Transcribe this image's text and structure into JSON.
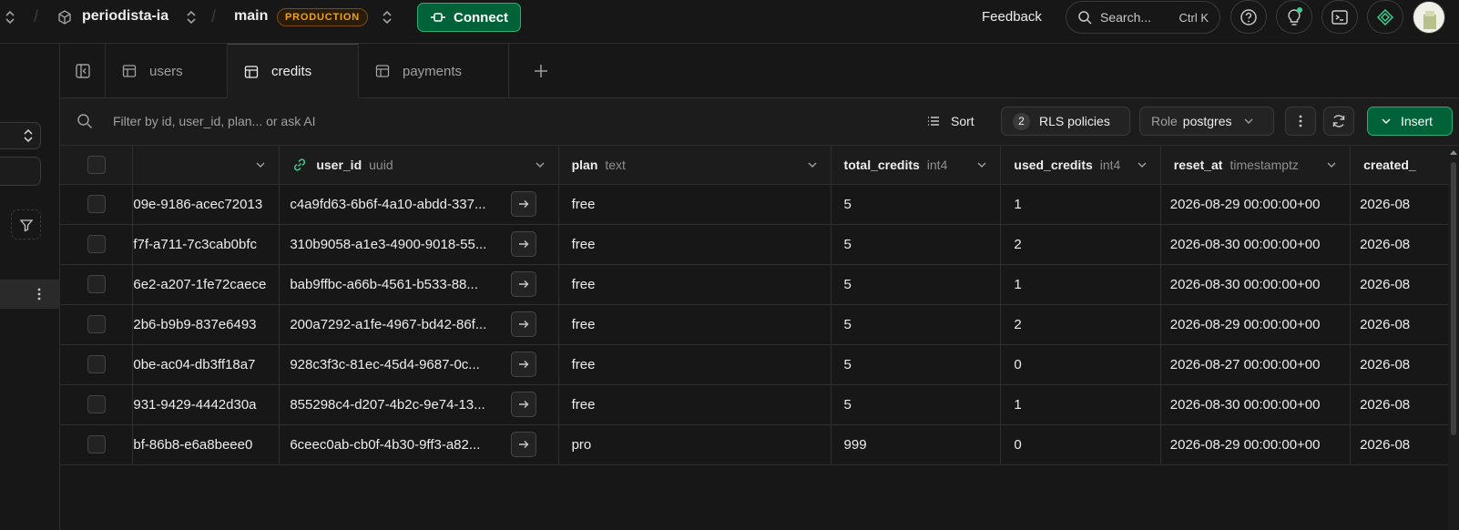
{
  "topbar": {
    "project": "periodista-ia",
    "branch": "main",
    "env_badge": "PRODUCTION",
    "connect_label": "Connect",
    "feedback_label": "Feedback",
    "search_label": "Search...",
    "search_shortcut": "Ctrl K"
  },
  "tabs": [
    {
      "label": "users"
    },
    {
      "label": "credits"
    },
    {
      "label": "payments"
    }
  ],
  "toolbar": {
    "filter_placeholder": "Filter by id, user_id, plan... or ask AI",
    "sort_label": "Sort",
    "rls_count": "2",
    "rls_label": "RLS policies",
    "role_label": "Role",
    "role_value": "postgres",
    "insert_label": "Insert"
  },
  "columns": [
    {
      "name": "",
      "type": ""
    },
    {
      "name": "user_id",
      "type": "uuid"
    },
    {
      "name": "plan",
      "type": "text"
    },
    {
      "name": "total_credits",
      "type": "int4"
    },
    {
      "name": "used_credits",
      "type": "int4"
    },
    {
      "name": "reset_at",
      "type": "timestamptz"
    },
    {
      "name": "created_",
      "type": ""
    }
  ],
  "rows": [
    {
      "id": "09e-9186-acec72013",
      "user_id": "c4a9fd63-6b6f-4a10-abdd-337...",
      "plan": "free",
      "total": "5",
      "used": "1",
      "reset": "2026-08-29 00:00:00+00",
      "created": "2026-08"
    },
    {
      "id": "f7f-a711-7c3cab0bfc",
      "user_id": "310b9058-a1e3-4900-9018-55...",
      "plan": "free",
      "total": "5",
      "used": "2",
      "reset": "2026-08-30 00:00:00+00",
      "created": "2026-08"
    },
    {
      "id": "6e2-a207-1fe72caece",
      "user_id": "bab9ffbc-a66b-4561-b533-88...",
      "plan": "free",
      "total": "5",
      "used": "1",
      "reset": "2026-08-30 00:00:00+00",
      "created": "2026-08"
    },
    {
      "id": "2b6-b9b9-837e6493",
      "user_id": "200a7292-a1fe-4967-bd42-86f...",
      "plan": "free",
      "total": "5",
      "used": "2",
      "reset": "2026-08-29 00:00:00+00",
      "created": "2026-08"
    },
    {
      "id": "0be-ac04-db3ff18a7",
      "user_id": "928c3f3c-81ec-45d4-9687-0c...",
      "plan": "free",
      "total": "5",
      "used": "0",
      "reset": "2026-08-27 00:00:00+00",
      "created": "2026-08"
    },
    {
      "id": "931-9429-4442d30a",
      "user_id": "855298c4-d207-4b2c-9e74-13...",
      "plan": "free",
      "total": "5",
      "used": "1",
      "reset": "2026-08-30 00:00:00+00",
      "created": "2026-08"
    },
    {
      "id": "bf-86b8-e6a8beee0",
      "user_id": "6ceec0ab-cb0f-4b30-9ff3-a82...",
      "plan": "pro",
      "total": "999",
      "used": "0",
      "reset": "2026-08-29 00:00:00+00",
      "created": "2026-08"
    }
  ],
  "colors": {
    "accent": "#3ecf8e",
    "connect_bg": "#006239",
    "insert_bg": "#006239",
    "badge": "#f1a10d"
  }
}
